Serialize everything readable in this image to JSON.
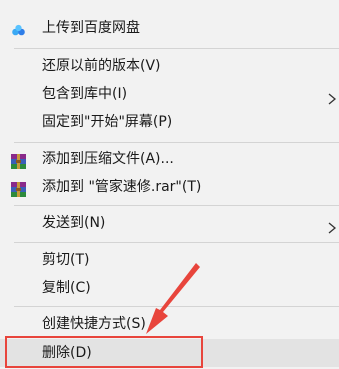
{
  "context_menu": {
    "items": [
      {
        "label": "上传到百度网盘",
        "icon": "baidu-netdisk-icon"
      },
      {
        "label": "还原以前的版本(V)"
      },
      {
        "label": "包含到库中(I)",
        "submenu": true
      },
      {
        "label": "固定到\"开始\"屏幕(P)"
      },
      {
        "label": "添加到压缩文件(A)...",
        "icon": "winrar-icon"
      },
      {
        "label": "添加到 \"管家速修.rar\"(T)",
        "icon": "winrar-icon"
      },
      {
        "label": "发送到(N)",
        "submenu": true
      },
      {
        "label": "剪切(T)"
      },
      {
        "label": "复制(C)"
      },
      {
        "label": "创建快捷方式(S)"
      },
      {
        "label": "删除(D)",
        "highlighted": true
      }
    ]
  },
  "colors": {
    "menu_background": "#f2f2f2",
    "hover_background": "#e3e3e3",
    "separator": "#d4d4d4",
    "annotation_red": "#e8453c"
  },
  "icons": {
    "submenu_indicator": "chevron-right-icon",
    "annotation": "red-arrow-pointer"
  }
}
